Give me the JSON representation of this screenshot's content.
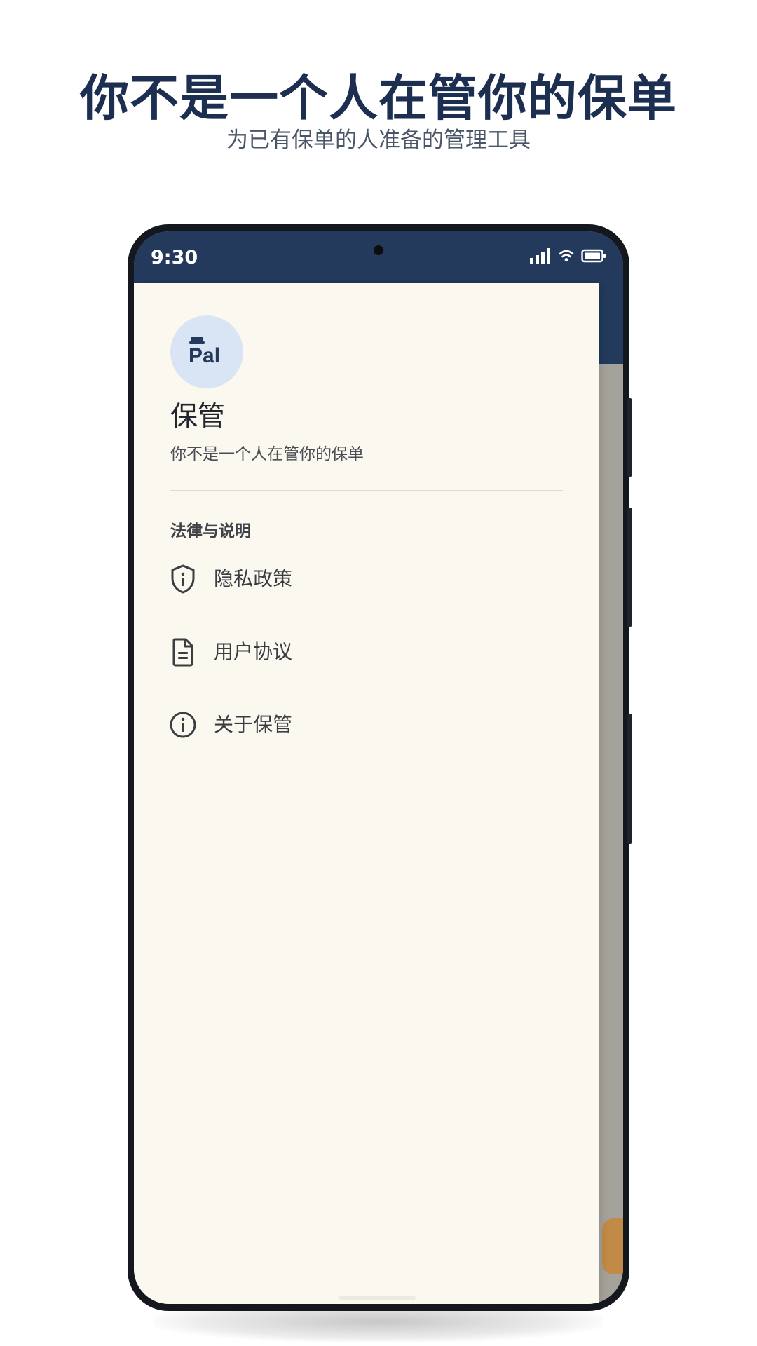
{
  "promo": {
    "title": "你不是一个人在管你的保单",
    "subtitle": "为已有保单的人准备的管理工具"
  },
  "status_bar": {
    "time": "9:30",
    "icons": [
      "signal-icon",
      "wifi-icon",
      "battery-icon"
    ]
  },
  "drawer": {
    "logo_text": "Pal",
    "app_name": "保管",
    "slogan": "你不是一个人在管你的保单",
    "section_title": "法律与说明",
    "items": [
      {
        "label": "隐私政策",
        "icon": "shield-info-icon"
      },
      {
        "label": "用户协议",
        "icon": "document-icon"
      },
      {
        "label": "关于保管",
        "icon": "info-icon"
      }
    ]
  },
  "colors": {
    "brand_navy": "#233a5c",
    "title_navy": "#1c2f50",
    "drawer_bg": "#fbf8ef",
    "avatar_bg": "#d9e5f4",
    "scrim": "#a5a29b",
    "accent_orange": "#c18a46"
  }
}
